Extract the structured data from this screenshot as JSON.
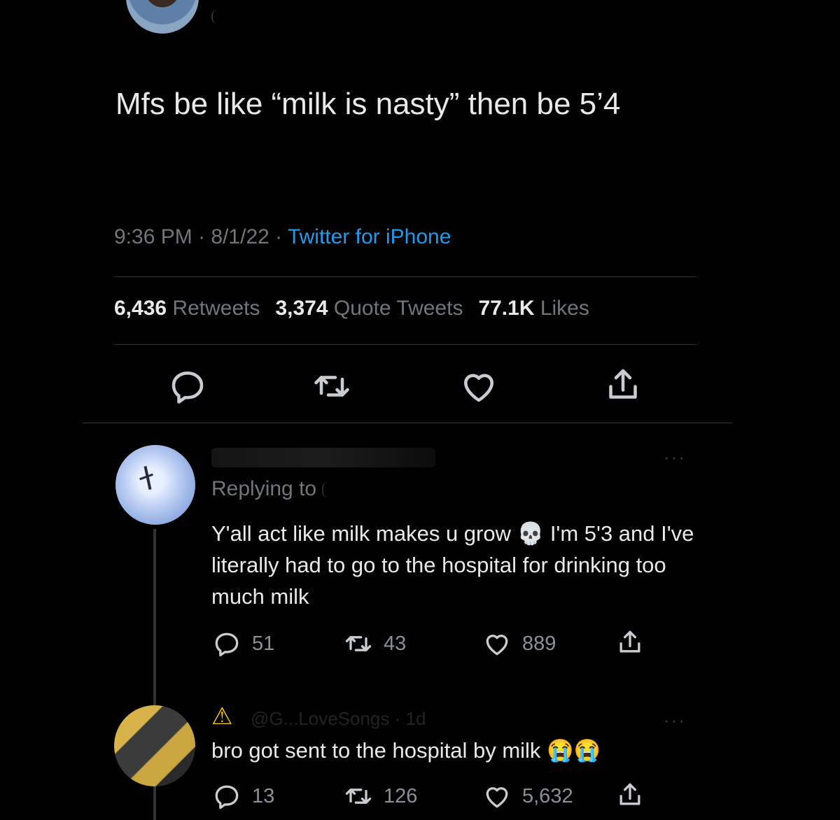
{
  "tweet": {
    "text": "Mfs be like “milk is nasty” then be 5’4",
    "time": "9:36 PM",
    "sep1": " · ",
    "date": "8/1/22",
    "sep2": " · ",
    "source": "Twitter for iPhone",
    "stats": {
      "retweets_count": "6,436",
      "retweets_label": " Retweets",
      "quotes_count": "3,374",
      "quotes_label": " Quote Tweets",
      "likes_count": "77.1K",
      "likes_label": " Likes"
    },
    "actions": [
      "comment-icon",
      "retweet-icon",
      "heart-icon",
      "share-icon"
    ]
  },
  "replies": [
    {
      "replying_label": "Replying to",
      "text": "Y'all act like milk makes u grow 💀 I'm 5'3 and I've literally had to go to the hospital for drinking too much milk",
      "replies": "51",
      "retweets": "43",
      "likes": "889",
      "more": "···"
    },
    {
      "warning": "⚠",
      "handle_partial": "@G...LoveSongs · 1d",
      "text": "bro got sent to the hospital by milk 😭😭",
      "replies": "13",
      "retweets": "126",
      "likes": "5,632",
      "more": "···"
    }
  ],
  "colors": {
    "background": "#000000",
    "text": "#e7e9ea",
    "muted": "#71767b",
    "link": "#1d9bf0",
    "divider": "#2f3336"
  }
}
